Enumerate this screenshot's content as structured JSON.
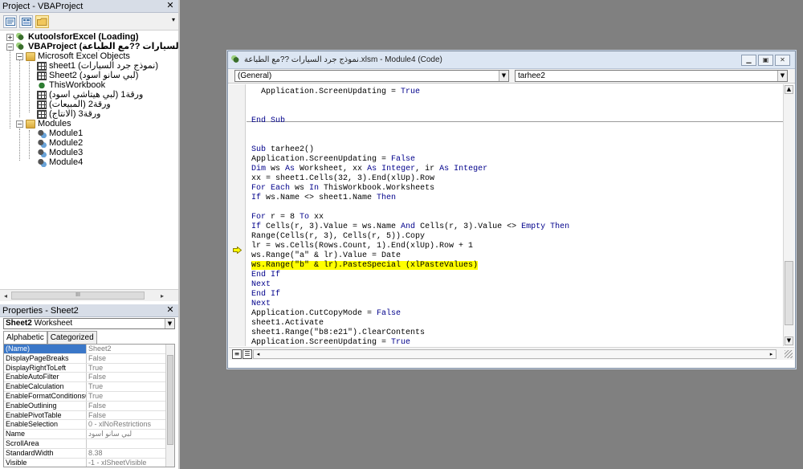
{
  "project_pane": {
    "title": "Project - VBAProject",
    "tree": [
      {
        "label": "KutoolsforExcel (Loading)",
        "bold": true
      },
      {
        "label": "VBAProject (نموذج جرد السيارات ??مع الطباعة)",
        "bold": true
      },
      {
        "label": "Microsoft Excel Objects"
      },
      {
        "label": "sheet1 (نموذج جرد السيارات)"
      },
      {
        "label": "Sheet2 (لبي سانو اسود)"
      },
      {
        "label": "ThisWorkbook"
      },
      {
        "label": "ورقة1 (لبي هيتاشي اسود)"
      },
      {
        "label": "ورقة2 (المبيعات)"
      },
      {
        "label": "ورقة3 (الانتاج)"
      },
      {
        "label": "Modules"
      },
      {
        "label": "Module1"
      },
      {
        "label": "Module2"
      },
      {
        "label": "Module3"
      },
      {
        "label": "Module4"
      }
    ],
    "scroll_thumb": "III"
  },
  "properties_pane": {
    "title": "Properties - Sheet2",
    "object_bold": "Sheet2",
    "object_type": "Worksheet",
    "tabs": [
      "Alphabetic",
      "Categorized"
    ],
    "rows": [
      {
        "key": "(Name)",
        "value": "Sheet2"
      },
      {
        "key": "DisplayPageBreaks",
        "value": "False"
      },
      {
        "key": "DisplayRightToLeft",
        "value": "True"
      },
      {
        "key": "EnableAutoFilter",
        "value": "False"
      },
      {
        "key": "EnableCalculation",
        "value": "True"
      },
      {
        "key": "EnableFormatConditionsCalc",
        "value": "True"
      },
      {
        "key": "EnableOutlining",
        "value": "False"
      },
      {
        "key": "EnablePivotTable",
        "value": "False"
      },
      {
        "key": "EnableSelection",
        "value": "0 - xlNoRestrictions"
      },
      {
        "key": "Name",
        "value": "لبي سانو اسود"
      },
      {
        "key": "ScrollArea",
        "value": ""
      },
      {
        "key": "StandardWidth",
        "value": "8.38"
      },
      {
        "key": "Visible",
        "value": "-1 - xlSheetVisible"
      }
    ]
  },
  "code_window": {
    "title": "نموذج جرد السيارات ??مع الطباعة.xlsm - Module4 (Code)",
    "object_combo": "(General)",
    "proc_combo": "tarhee2",
    "buttons": [
      "minimize",
      "restore",
      "close"
    ],
    "lines": [
      [
        {
          "t": "  Application.ScreenUpdating = "
        },
        {
          "t": "True",
          "k": 1
        }
      ],
      [],
      [],
      [
        {
          "t": "End Sub",
          "k": 1
        }
      ],
      [],
      [],
      [
        {
          "t": "Sub",
          "k": 1
        },
        {
          "t": " tarhee2()"
        }
      ],
      [
        {
          "t": "Application.ScreenUpdating = "
        },
        {
          "t": "False",
          "k": 1
        }
      ],
      [
        {
          "t": "Dim",
          "k": 1
        },
        {
          "t": " ws "
        },
        {
          "t": "As",
          "k": 1
        },
        {
          "t": " Worksheet, xx "
        },
        {
          "t": "As Integer",
          "k": 1
        },
        {
          "t": ", ir "
        },
        {
          "t": "As Integer",
          "k": 1
        }
      ],
      [
        {
          "t": "xx = sheet1.Cells(32, 3).End(xlUp).Row"
        }
      ],
      [
        {
          "t": "For Each",
          "k": 1
        },
        {
          "t": " ws "
        },
        {
          "t": "In",
          "k": 1
        },
        {
          "t": " ThisWorkbook.Worksheets"
        }
      ],
      [
        {
          "t": "If",
          "k": 1
        },
        {
          "t": " ws.Name <> sheet1.Name "
        },
        {
          "t": "Then",
          "k": 1
        }
      ],
      [],
      [
        {
          "t": "For",
          "k": 1
        },
        {
          "t": " r = 8 "
        },
        {
          "t": "To",
          "k": 1
        },
        {
          "t": " xx"
        }
      ],
      [
        {
          "t": "If",
          "k": 1
        },
        {
          "t": " Cells(r, 3).Value = ws.Name "
        },
        {
          "t": "And",
          "k": 1
        },
        {
          "t": " Cells(r, 3).Value <> "
        },
        {
          "t": "Empty Then",
          "k": 1
        }
      ],
      [
        {
          "t": "Range(Cells(r, 3), Cells(r, 5)).Copy"
        }
      ],
      [
        {
          "t": "lr = ws.Cells(Rows.Count, 1).End(xlUp).Row + 1"
        }
      ],
      [
        {
          "t": "ws.Range(\"a\" & lr).Value = Date"
        }
      ],
      [
        {
          "t": "ws.Range(\"b\" & lr).PasteSpecial (xlPasteValues)",
          "h": 1
        }
      ],
      [
        {
          "t": "End If",
          "k": 1
        }
      ],
      [
        {
          "t": "Next",
          "k": 1
        }
      ],
      [
        {
          "t": "End If",
          "k": 1
        }
      ],
      [
        {
          "t": "Next",
          "k": 1
        }
      ],
      [
        {
          "t": "Application.CutCopyMode = "
        },
        {
          "t": "False",
          "k": 1
        }
      ],
      [
        {
          "t": "sheet1.Activate"
        }
      ],
      [
        {
          "t": "sheet1.Range(\"b8:e21\").ClearContents"
        }
      ],
      [
        {
          "t": "Application.ScreenUpdating = "
        },
        {
          "t": "True",
          "k": 1
        }
      ],
      [
        {
          "t": "End Sub",
          "k": 1
        }
      ]
    ]
  },
  "colors": {
    "keyword": "#00008b",
    "highlight": "#ffff00",
    "background": "#808080"
  },
  "icons": [
    "view-project-icon",
    "view-object-icon",
    "toggle-folders-icon",
    "close-icon",
    "execution-arrow-icon",
    "chevron-down-icon"
  ]
}
